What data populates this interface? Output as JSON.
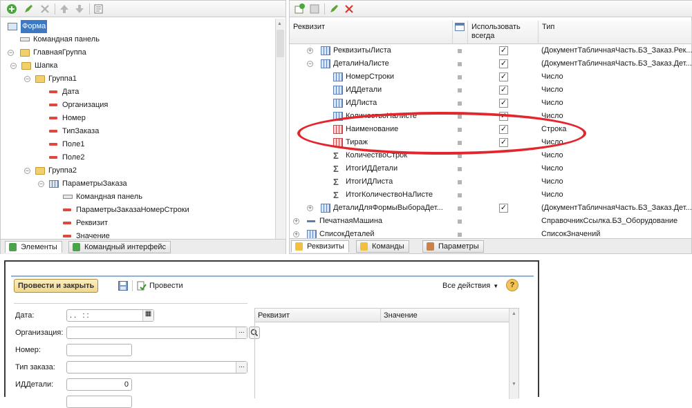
{
  "left_panel": {
    "tree": [
      {
        "label": "Форма",
        "icon": "form-icon",
        "selected": true
      },
      {
        "label": "Командная панель",
        "icon": "command-panel-icon"
      },
      {
        "label": "ГлавнаяГруппа",
        "icon": "folder-icon"
      },
      {
        "label": "Шапка",
        "icon": "folder-icon"
      },
      {
        "label": "Группа1",
        "icon": "folder-icon"
      },
      {
        "label": "Дата",
        "icon": "field-icon"
      },
      {
        "label": "Организация",
        "icon": "field-icon"
      },
      {
        "label": "Номер",
        "icon": "field-icon"
      },
      {
        "label": "ТипЗаказа",
        "icon": "field-icon"
      },
      {
        "label": "Поле1",
        "icon": "field-icon"
      },
      {
        "label": "Поле2",
        "icon": "field-icon"
      },
      {
        "label": "Группа2",
        "icon": "folder-icon"
      },
      {
        "label": "ПараметрыЗаказа",
        "icon": "table-icon"
      },
      {
        "label": "Командная панель",
        "icon": "command-panel-icon"
      },
      {
        "label": "ПараметрыЗаказаНомерСтроки",
        "icon": "field-icon"
      },
      {
        "label": "Реквизит",
        "icon": "field-icon"
      },
      {
        "label": "Значение",
        "icon": "field-icon"
      }
    ],
    "tabs": [
      {
        "label": "Элементы",
        "active": true
      },
      {
        "label": "Командный интерфейс",
        "active": false
      }
    ]
  },
  "right_panel": {
    "headers": {
      "requisite": "Реквизит",
      "use_always": "Использовать всегда",
      "type": "Тип"
    },
    "rows": [
      {
        "name": "РеквизитыЛиста",
        "checked": true,
        "type": "(ДокументТабличнаяЧасть.БЗ_Заказ.Рек..."
      },
      {
        "name": "ДеталиНаЛисте",
        "checked": true,
        "type": "(ДокументТабличнаяЧасть.БЗ_Заказ.Дет..."
      },
      {
        "name": "НомерСтроки",
        "checked": true,
        "type": "Число"
      },
      {
        "name": "ИДДетали",
        "checked": true,
        "type": "Число"
      },
      {
        "name": "ИДЛиста",
        "checked": true,
        "type": "Число"
      },
      {
        "name": "КоличествоНаЛисте",
        "checked": true,
        "type": "Число"
      },
      {
        "name": "Наименование",
        "checked": true,
        "type": "Строка"
      },
      {
        "name": "Тираж",
        "checked": true,
        "type": "Число"
      },
      {
        "name": "КоличествоСтрок",
        "checked": false,
        "type": "Число"
      },
      {
        "name": "ИтогИДДетали",
        "checked": false,
        "type": "Число"
      },
      {
        "name": "ИтогИДЛиста",
        "checked": false,
        "type": "Число"
      },
      {
        "name": "ИтогКоличествоНаЛисте",
        "checked": false,
        "type": "Число"
      },
      {
        "name": "ДеталиДляФормыВыбораДет...",
        "checked": true,
        "type": "(ДокументТабличнаяЧасть.БЗ_Заказ.Дет..."
      },
      {
        "name": "ПечатнаяМашина",
        "checked": false,
        "type": "СправочникСсылка.БЗ_Оборудование"
      },
      {
        "name": "СписокДеталей",
        "checked": false,
        "type": "СписокЗначений"
      }
    ],
    "tabs": [
      {
        "label": "Реквизиты",
        "active": true
      },
      {
        "label": "Команды",
        "active": false
      },
      {
        "label": "Параметры",
        "active": false
      }
    ]
  },
  "form_preview": {
    "post_close_button": "Провести и закрыть",
    "post_button": "Провести",
    "all_actions": "Все действия",
    "help": "?",
    "fields": [
      {
        "label": "Дата:",
        "value": ". .   : :"
      },
      {
        "label": "Организация:",
        "value": ""
      },
      {
        "label": "Номер:",
        "value": ""
      },
      {
        "label": "Тип заказа:",
        "value": ""
      },
      {
        "label": "ИДДетали:",
        "value": "0"
      }
    ],
    "table_headers": {
      "requisite": "Реквизит",
      "value": "Значение"
    }
  },
  "colors": {
    "accent": "#3d78c4",
    "annotation": "#e3262c",
    "field_marker": "#e0483f",
    "folder": "#f2cf6b"
  }
}
